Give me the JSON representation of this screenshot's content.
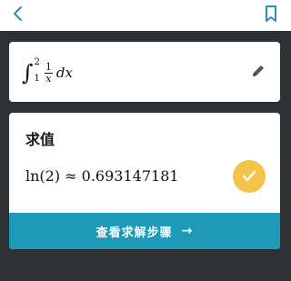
{
  "expression": {
    "integral_sign": "∫",
    "upper_limit": "2",
    "lower_limit": "1",
    "numerator": "1",
    "denominator": "x",
    "differential": "dx"
  },
  "result": {
    "title": "求值",
    "value": "ln(2) ≈ 0.693147181"
  },
  "steps_button": {
    "label": "查看求解步骤",
    "arrow": "→"
  },
  "icons": {
    "back": "chevron-left-icon",
    "bookmark": "bookmark-icon",
    "edit": "pencil-icon",
    "check": "check-icon"
  },
  "colors": {
    "accent": "#1f9ab6",
    "check_badge": "#f4c44a",
    "background": "#2f3235"
  }
}
